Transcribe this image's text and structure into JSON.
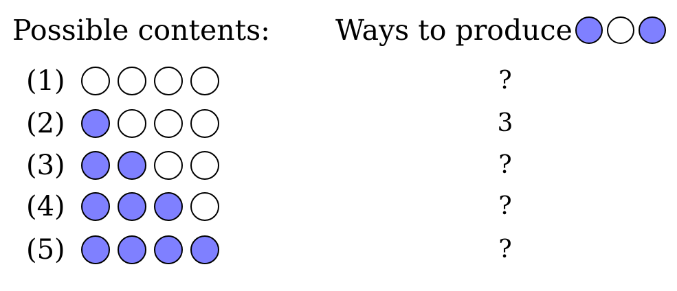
{
  "header": {
    "left_label": "Possible contents:",
    "right_label": "Ways to produce",
    "target_sequence": [
      "blue",
      "white",
      "blue"
    ]
  },
  "colors": {
    "blue": "#7f80ff",
    "white": "#ffffff",
    "outline": "#000000"
  },
  "rows": [
    {
      "label": "(1)",
      "marbles": [
        "white",
        "white",
        "white",
        "white"
      ],
      "ways": "?"
    },
    {
      "label": "(2)",
      "marbles": [
        "blue",
        "white",
        "white",
        "white"
      ],
      "ways": "3"
    },
    {
      "label": "(3)",
      "marbles": [
        "blue",
        "blue",
        "white",
        "white"
      ],
      "ways": "?"
    },
    {
      "label": "(4)",
      "marbles": [
        "blue",
        "blue",
        "blue",
        "white"
      ],
      "ways": "?"
    },
    {
      "label": "(5)",
      "marbles": [
        "blue",
        "blue",
        "blue",
        "blue"
      ],
      "ways": "?"
    }
  ]
}
